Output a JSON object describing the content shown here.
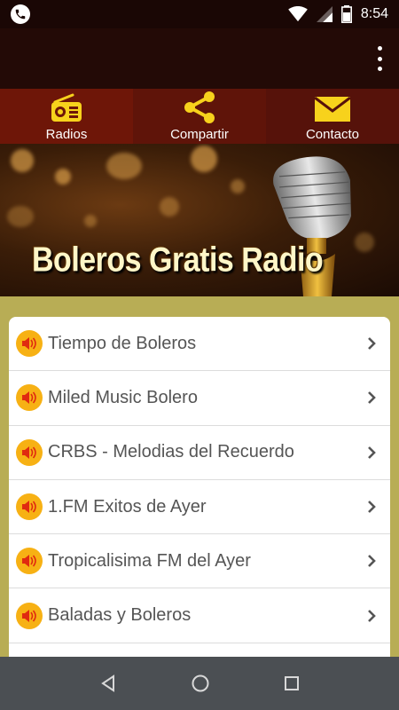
{
  "status_bar": {
    "time": "8:54",
    "icons": [
      "phone-notification-icon",
      "wifi-icon",
      "signal-icon",
      "battery-icon"
    ]
  },
  "app_bar": {
    "overflow_icon": "more-vert-icon"
  },
  "tabs": [
    {
      "label": "Radios",
      "icon": "radio-icon"
    },
    {
      "label": "Compartir",
      "icon": "share-icon"
    },
    {
      "label": "Contacto",
      "icon": "mail-icon"
    }
  ],
  "banner": {
    "title": "Boleros Gratis Radio"
  },
  "stations": [
    {
      "label": "Tiempo de Boleros"
    },
    {
      "label": "Miled Music Bolero"
    },
    {
      "label": "CRBS - Melodias del Recuerdo"
    },
    {
      "label": "1.FM Exitos de Ayer"
    },
    {
      "label": "Tropicalisima FM del Ayer"
    },
    {
      "label": "Baladas y Boleros"
    }
  ],
  "colors": {
    "accent_yellow": "#f7d21c",
    "speaker_orange": "#f7b114",
    "tab_bg": "#5a1208",
    "page_bg": "#b8ad55"
  },
  "nav_bar": {
    "icons": [
      "back-icon",
      "home-icon",
      "recents-icon"
    ]
  }
}
